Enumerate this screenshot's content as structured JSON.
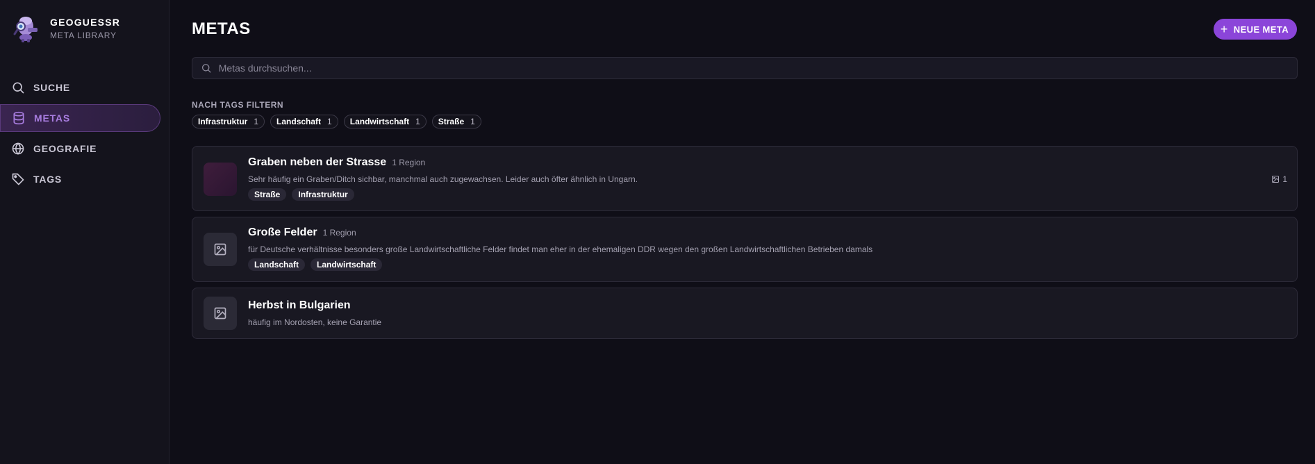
{
  "brand": {
    "title": "GEOGUESSR",
    "subtitle": "META LIBRARY",
    "accent_color": "#8b45d9"
  },
  "sidebar": {
    "items": [
      {
        "label": "SUCHE",
        "icon": "search-icon",
        "active": false
      },
      {
        "label": "METAS",
        "icon": "database-icon",
        "active": true
      },
      {
        "label": "GEOGRAFIE",
        "icon": "globe-icon",
        "active": false
      },
      {
        "label": "TAGS",
        "icon": "tag-icon",
        "active": false
      }
    ]
  },
  "header": {
    "title": "METAS",
    "new_button_label": "NEUE META"
  },
  "search": {
    "placeholder": "Metas durchsuchen..."
  },
  "filters": {
    "label": "NACH TAGS FILTERN",
    "tags": [
      {
        "name": "Infrastruktur",
        "count": "1"
      },
      {
        "name": "Landschaft",
        "count": "1"
      },
      {
        "name": "Landwirtschaft",
        "count": "1"
      },
      {
        "name": "Straße",
        "count": "1"
      }
    ]
  },
  "metas": [
    {
      "title": "Graben neben der Strasse",
      "region": "1 Region",
      "description": "Sehr häufig ein Graben/Ditch sichbar, manchmal auch zugewachsen. Leider auch öfter ähnlich in Ungarn.",
      "tags": [
        "Straße",
        "Infrastruktur"
      ],
      "image_count": "1"
    },
    {
      "title": "Große Felder",
      "region": "1 Region",
      "description": "für Deutsche verhältnisse besonders große Landwirtschaftliche Felder findet man eher in der ehemaligen DDR wegen den großen Landwirtschaftlichen Betrieben damals",
      "tags": [
        "Landschaft",
        "Landwirtschaft"
      ]
    },
    {
      "title": "Herbst in Bulgarien",
      "description": "häufig im Nordosten, keine Garantie"
    }
  ]
}
